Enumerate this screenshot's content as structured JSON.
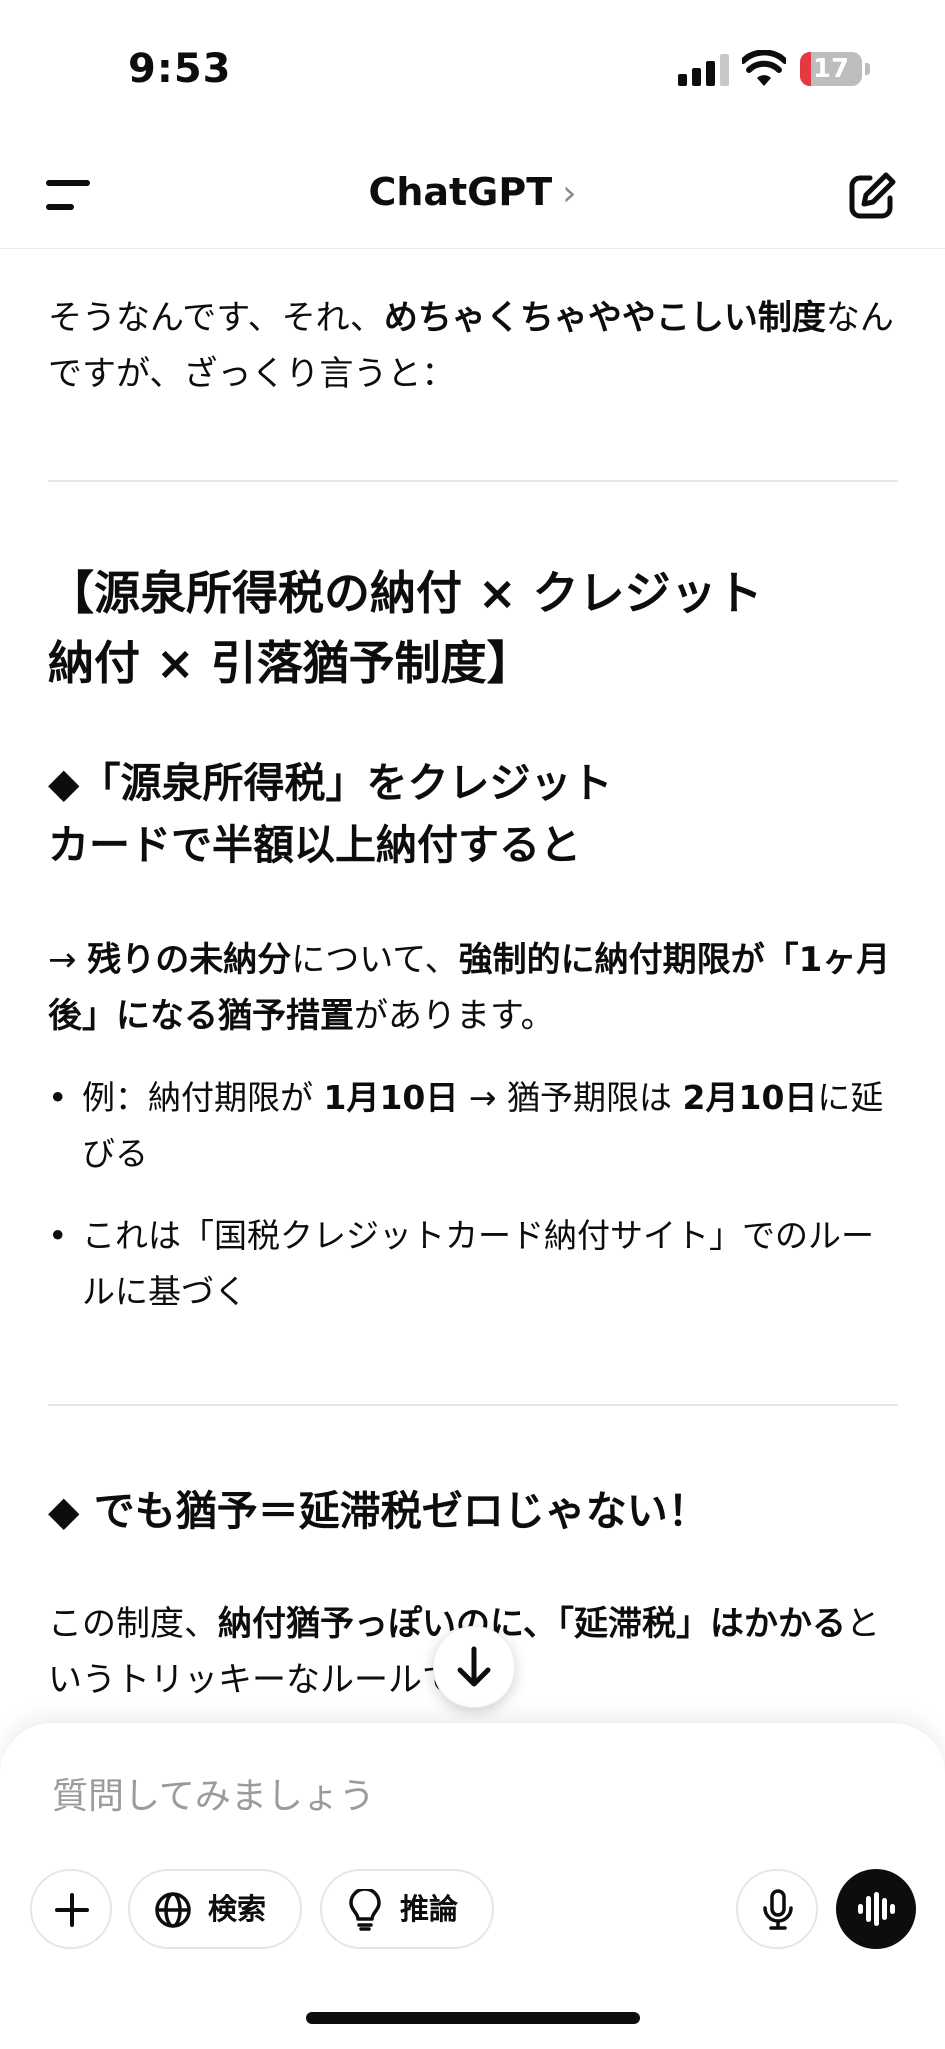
{
  "status_bar": {
    "time": "9:53",
    "battery": "17",
    "battery_level": 0.17,
    "battery_color": "#e5393f"
  },
  "nav": {
    "title": "ChatGPT",
    "chevron": "›",
    "icons": [
      "menu-icon",
      "new-chat-icon"
    ]
  },
  "message": {
    "intro": {
      "t1": "そうなんです、それ、",
      "b1": "めちゃくちゃややこしい制度",
      "t2": "なんですが、ざっくり言うと："
    },
    "heading_main": {
      "line1": "【源泉所得税の納付 × クレジット",
      "line2": "納付 × 引落猶予制度】"
    },
    "heading_sub1": {
      "line1": "◆「源泉所得税」をクレジット",
      "line2": "カードで半額以上納付すると"
    },
    "para1": {
      "t1": "→ ",
      "b1": "残りの未納分",
      "t2": "について、",
      "b2": "強制的に納付期限が「1ヶ月後」になる猶予措置",
      "t3": "があります。"
    },
    "bullet1": {
      "t1": "例：納付期限が ",
      "b1": "1月10日",
      "t2": " → 猶予期限は ",
      "b2": "2月10日",
      "t3": "に延びる"
    },
    "bullet2": {
      "t1": "これは「国税クレジットカード納付サイト」でのルールに基づく"
    },
    "bullet_marker": "•",
    "heading_sub2": "◆ でも猶予＝延滞税ゼロじゃない！",
    "para2": {
      "t1": "この制度、",
      "b1": "納付猶予っぽいのに、「延滞税」はかかる",
      "t2": "というトリッキーなルールです。"
    }
  },
  "composer": {
    "placeholder": "質問してみましょう",
    "search_label": "検索",
    "reason_label": "推論",
    "icons": [
      "plus-icon",
      "globe-icon",
      "lightbulb-icon",
      "mic-icon",
      "voice-waveform-icon",
      "arrow-down-icon"
    ]
  }
}
